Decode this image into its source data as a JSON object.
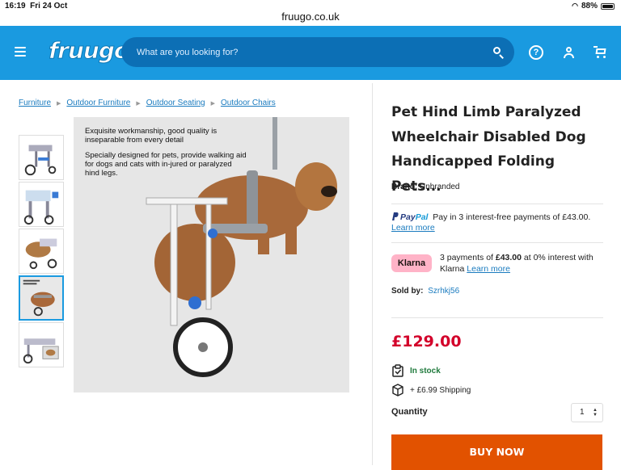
{
  "status_bar": {
    "time": "16:19",
    "date": "Fri 24 Oct",
    "battery": "88%"
  },
  "browser": {
    "url": "fruugo.co.uk"
  },
  "header": {
    "logo": "fruugo",
    "search_placeholder": "What are you looking for?",
    "help_label": "?"
  },
  "breadcrumb": [
    "Furniture",
    "Outdoor Furniture",
    "Outdoor Seating",
    "Outdoor Chairs"
  ],
  "main_image": {
    "caption_1": "Exquisite workmanship, good quality is inseparable from every detail",
    "caption_2": "Specially designed for pets, provide walking aid for dogs and cats with in-jured or paralyzed hind legs."
  },
  "product": {
    "title": "Pet Hind Limb Paralyzed Wheelchair Disabled Dog Handicapped Folding Pets...",
    "brand_label": "Brand:",
    "brand_value": "Unbranded",
    "paypal": {
      "logo_pay": "Pay",
      "logo_pal": "Pal",
      "text": "Pay in 3 interest-free payments of £43.00.",
      "link": "Learn more"
    },
    "klarna": {
      "badge": "Klarna",
      "text_pre": "3 payments of ",
      "amount": "£43.00",
      "text_post": " at 0% interest with Klarna ",
      "link": "Learn more"
    },
    "sold_by_label": "Sold by:",
    "sold_by_value": "Szrhkj56",
    "price": "£129.00",
    "stock": "In stock",
    "shipping": "+ £6.99 Shipping",
    "quantity_label": "Quantity",
    "quantity_value": "1",
    "buy_now": "BUY NOW"
  },
  "colors": {
    "brand_blue": "#1a9ae0",
    "price_red": "#d3002a",
    "buy_orange": "#e25200",
    "stock_green": "#207a3d"
  }
}
